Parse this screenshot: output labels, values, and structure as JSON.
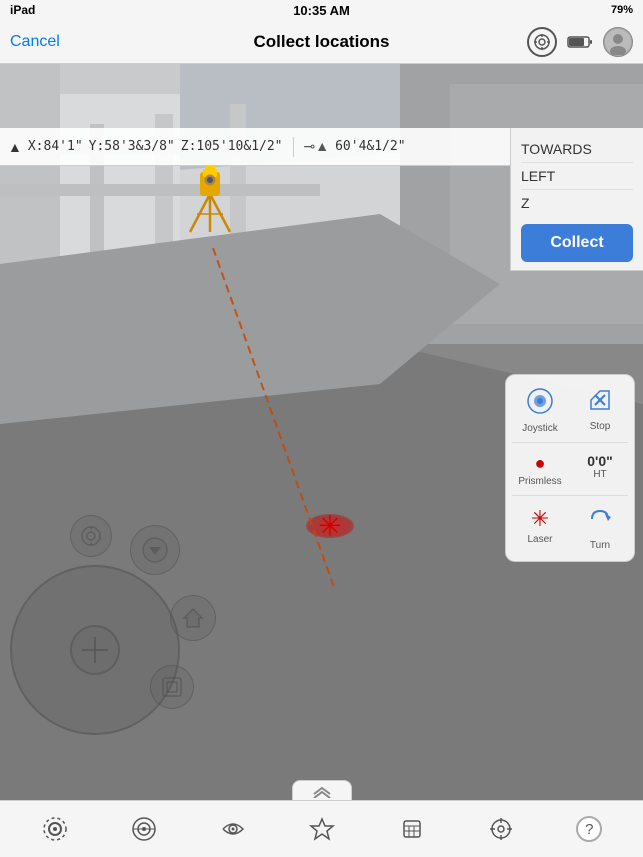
{
  "statusBar": {
    "device": "iPad",
    "time": "10:35 AM",
    "battery": "79%"
  },
  "navBar": {
    "cancelLabel": "Cancel",
    "title": "Collect locations",
    "icons": {
      "target": "⊕",
      "battery": "🔋",
      "user": "👤"
    }
  },
  "coordBar": {
    "alertIcon": "▲",
    "x": "X:84'1\"",
    "y": "Y:58'3&3/8\"",
    "z": "Z:105'10&1/2\"",
    "bearingIcon": "—▲",
    "bearing": "60'4&1/2\""
  },
  "infoPanel": {
    "towards": "TOWARDS",
    "left": "LEFT",
    "zLabel": "Z",
    "collectLabel": "Collect"
  },
  "instrumentPanel": {
    "joystick": "Joystick",
    "stop": "Stop",
    "prismless": "Prismless",
    "ht": "HT",
    "htValue": "0'0\"",
    "laser": "Laser",
    "turn": "Turn"
  },
  "bottomToolbar": {
    "icons": [
      {
        "id": "scan-icon",
        "symbol": "◎",
        "active": false
      },
      {
        "id": "layers-icon",
        "symbol": "⊗",
        "active": false
      },
      {
        "id": "eye-icon",
        "symbol": "👁",
        "active": false
      },
      {
        "id": "bookmark-icon",
        "symbol": "✦",
        "active": false
      },
      {
        "id": "key-icon",
        "symbol": "⌗",
        "active": false
      },
      {
        "id": "crosshair-icon",
        "symbol": "⊕",
        "active": false
      },
      {
        "id": "help-icon",
        "symbol": "?",
        "active": false
      }
    ]
  },
  "colors": {
    "accent": "#3b7dd8",
    "laserRed": "#cc0000",
    "panelBg": "rgba(248,248,248,0.95)"
  }
}
